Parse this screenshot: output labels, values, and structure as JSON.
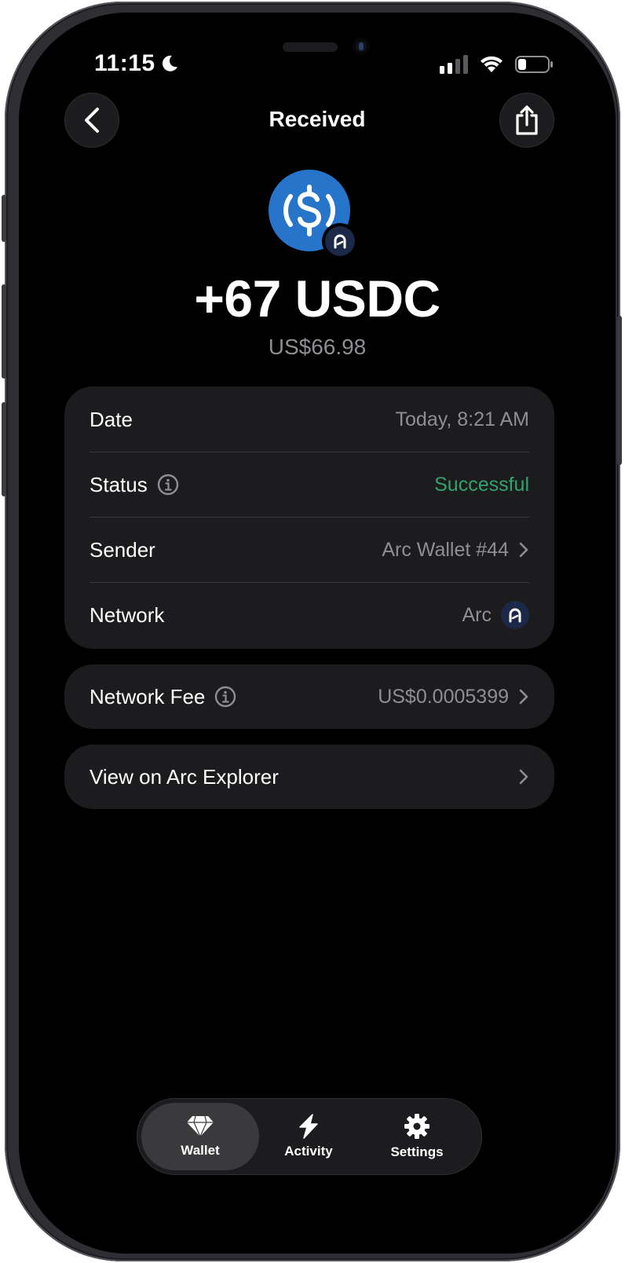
{
  "status_bar": {
    "time": "11:15"
  },
  "header": {
    "title": "Received"
  },
  "transaction": {
    "amount": "+67 USDC",
    "fiat_value": "US$66.98"
  },
  "details": {
    "date_label": "Date",
    "date_value": "Today, 8:21 AM",
    "status_label": "Status",
    "status_value": "Successful",
    "sender_label": "Sender",
    "sender_value": "Arc Wallet #44",
    "network_label": "Network",
    "network_value": "Arc"
  },
  "fee": {
    "label": "Network Fee",
    "value": "US$0.0005399"
  },
  "explorer": {
    "label": "View on Arc Explorer"
  },
  "tabs": [
    {
      "label": "Wallet",
      "icon": "gem-icon",
      "active": true
    },
    {
      "label": "Activity",
      "icon": "bolt-icon",
      "active": false
    },
    {
      "label": "Settings",
      "icon": "gear-icon",
      "active": false
    }
  ],
  "colors": {
    "background": "#000000",
    "card": "#1c1c1e",
    "secondary_text": "#8e8e93",
    "success": "#30a46c",
    "usdc_blue": "#2775ca",
    "arc_badge": "#1b2847"
  }
}
